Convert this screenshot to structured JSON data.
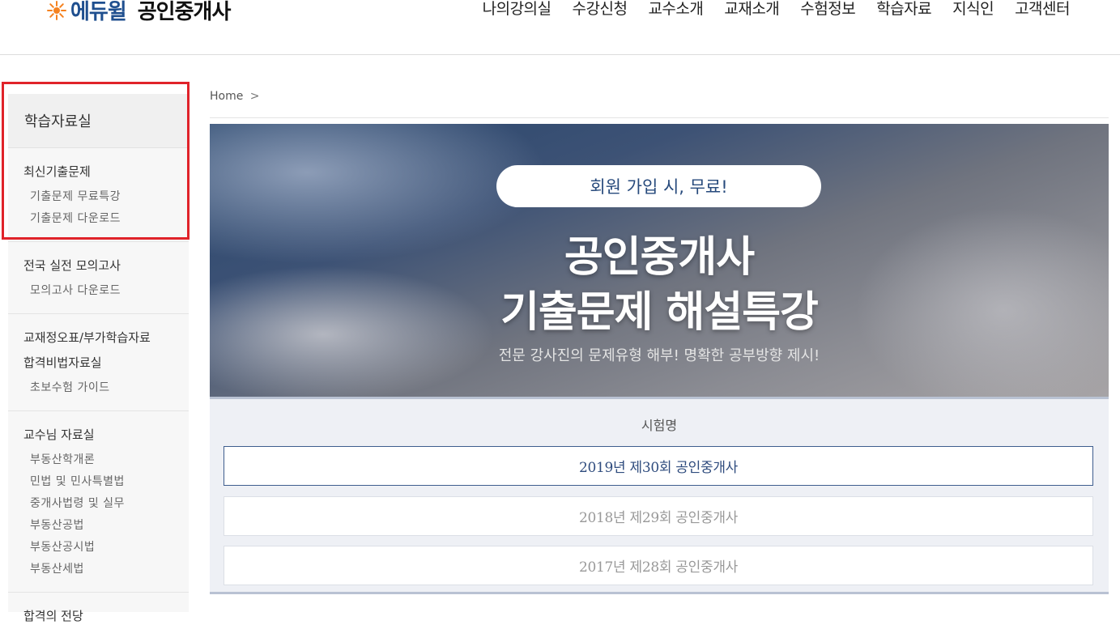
{
  "header": {
    "brand": "에듀윌",
    "title": "공인중개사",
    "nav": [
      "나의강의실",
      "수강신청",
      "교수소개",
      "교재소개",
      "수험정보",
      "학습자료",
      "지식인",
      "고객센터"
    ]
  },
  "sidebar": {
    "title": "학습자료실",
    "groups": [
      {
        "mains": [
          "최신기출문제"
        ],
        "subs": [
          "기출문제 무료특강",
          "기출문제 다운로드"
        ]
      },
      {
        "mains": [
          "전국 실전 모의고사"
        ],
        "subs": [
          "모의고사 다운로드"
        ]
      },
      {
        "mains": [
          "교재정오표/부가학습자료",
          "합격비법자료실"
        ],
        "subs": [
          "초보수험 가이드"
        ]
      },
      {
        "mains": [
          "교수님 자료실"
        ],
        "subs": [
          "부동산학개론",
          "민법 및 민사특별법",
          "중개사법령 및 실무",
          "부동산공법",
          "부동산공시법",
          "부동산세법"
        ]
      },
      {
        "mains": [
          "합격의 전당"
        ],
        "subs": []
      }
    ],
    "highlight_color": "#e0232a"
  },
  "breadcrumb": {
    "home": "Home",
    "separator": ">"
  },
  "banner": {
    "pill": "회원 가입 시, 무료!",
    "title_line1": "공인중개사",
    "title_line2": "기출문제 해설특강",
    "subtitle": "전문 강사진의 문제유형 해부! 명확한 공부방향 제시!"
  },
  "exam": {
    "header": "시험명",
    "items": [
      {
        "label": "2019년 제30회 공인중개사",
        "active": true
      },
      {
        "label": "2018년 제29회 공인중개사",
        "active": false
      },
      {
        "label": "2017년 제28회 공인중개사",
        "active": false
      }
    ]
  },
  "colors": {
    "brand_blue": "#1f4f8f",
    "accent_orange": "#f58220",
    "active_border": "#3e5d8e"
  }
}
